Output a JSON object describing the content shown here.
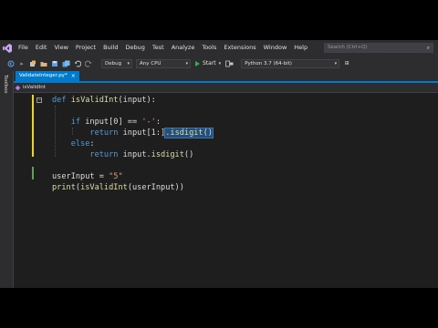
{
  "menubar": {
    "items": [
      "File",
      "Edit",
      "View",
      "Project",
      "Build",
      "Debug",
      "Test",
      "Analyze",
      "Tools",
      "Extensions",
      "Window",
      "Help"
    ],
    "search_placeholder": "Search (Ctrl+Q)",
    "logo_icon": "visual-studio-logo-icon"
  },
  "toolbar": {
    "config": "Debug",
    "platform": "Any CPU",
    "start_label": "Start",
    "python_env": "Python 3.7 (64-bit)"
  },
  "toolbox": {
    "label": "Toolbox"
  },
  "tabs": [
    {
      "label": "ValidateInteger.py*",
      "active": true
    }
  ],
  "navbar": {
    "member": "isValidInt"
  },
  "editor": {
    "lines": [
      "def isValidInt(input):",
      "",
      "    if input[0] == '-':",
      "        return input[1:].isdigit()",
      "    else:",
      "        return input.isdigit()",
      "",
      "userInput = \"5\"",
      "print(isValidInt(userInput))"
    ],
    "selected_text": ".isdigit()"
  },
  "colors": {
    "accent": "#007acc",
    "keyword": "#569cd6",
    "function": "#dcdcaa",
    "string": "#d69d85",
    "selection": "#264f78",
    "editor_bg": "#1e1e1e",
    "chrome_bg": "#2d2d30"
  }
}
